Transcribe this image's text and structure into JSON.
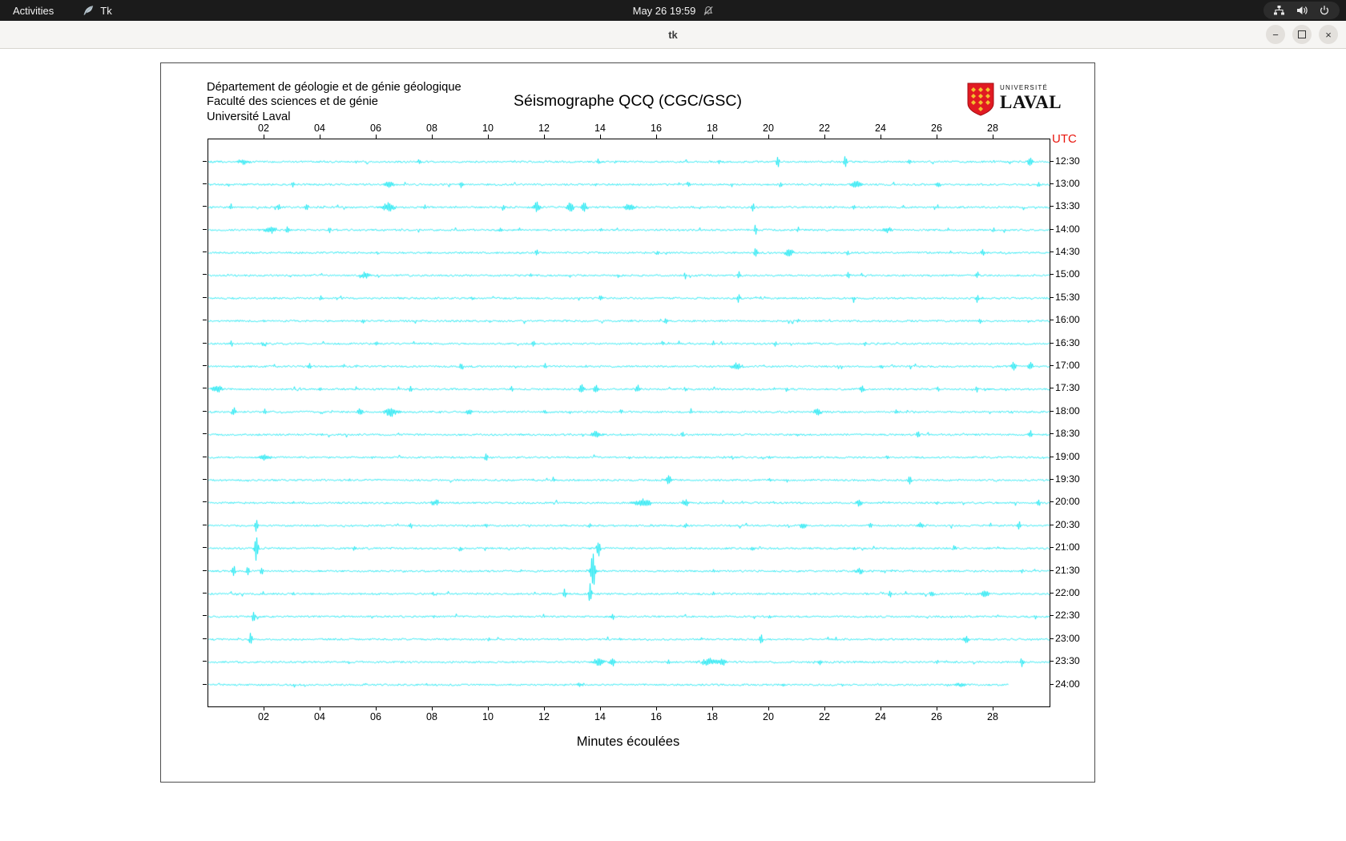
{
  "top_bar": {
    "activities_label": "Activities",
    "app_name": "Tk",
    "clock": "May 26 19:59"
  },
  "window": {
    "title": "tk",
    "minimize_glyph": "−",
    "close_glyph": "×"
  },
  "header": {
    "dept_lines": [
      "Département de géologie et de génie géologique",
      "Faculté des sciences et de génie",
      "Université Laval"
    ],
    "title": "Séismographe QCQ (CGC/GSC)",
    "logo": {
      "top": "UNIVERSITÉ",
      "bottom": "LAVAL"
    }
  },
  "colors": {
    "trace": "#00e4f0",
    "utc_label": "#e8150d",
    "topbar_bg": "#1b1b1b",
    "titlebar_bg": "#f6f5f3",
    "logo_red": "#e11a22",
    "logo_gold": "#f2c12e"
  },
  "chart_data": {
    "type": "line",
    "title": "Séismographe QCQ (CGC/GSC)",
    "xlabel": "Minutes écoulées",
    "right_axis_label": "UTC",
    "x_range": [
      0,
      30
    ],
    "x_ticks": [
      "02",
      "04",
      "06",
      "08",
      "10",
      "12",
      "14",
      "16",
      "18",
      "20",
      "22",
      "24",
      "26",
      "28"
    ],
    "trace_color": "#00e4f0",
    "noise_amp": 1.1,
    "rows": [
      {
        "utc": "12:30",
        "events": [
          [
            1.2,
            3,
            0.25
          ],
          [
            7.5,
            4,
            0.05
          ],
          [
            13.9,
            4,
            0.05
          ],
          [
            18.2,
            3,
            0.05
          ],
          [
            20.3,
            9,
            0.05
          ],
          [
            22.7,
            9,
            0.05
          ],
          [
            25.0,
            3,
            0.05
          ],
          [
            29.3,
            6,
            0.1
          ]
        ]
      },
      {
        "utc": "13:00",
        "events": [
          [
            3.0,
            3,
            0.05
          ],
          [
            6.4,
            4,
            0.18
          ],
          [
            9.0,
            4,
            0.05
          ],
          [
            13.8,
            3,
            0.05
          ],
          [
            17.1,
            4,
            0.05
          ],
          [
            20.4,
            3,
            0.05
          ],
          [
            23.1,
            5,
            0.18
          ],
          [
            26.0,
            3,
            0.1
          ],
          [
            29.6,
            5,
            0.05
          ]
        ]
      },
      {
        "utc": "13:30",
        "events": [
          [
            0.8,
            4,
            0.05
          ],
          [
            2.5,
            4,
            0.05
          ],
          [
            3.5,
            4,
            0.05
          ],
          [
            6.4,
            6,
            0.22
          ],
          [
            7.7,
            4,
            0.05
          ],
          [
            10.5,
            4,
            0.05
          ],
          [
            11.7,
            7,
            0.1
          ],
          [
            12.9,
            6,
            0.12
          ],
          [
            13.4,
            6,
            0.1
          ],
          [
            15.0,
            5,
            0.18
          ],
          [
            19.4,
            6,
            0.05
          ],
          [
            23.0,
            3,
            0.05
          ],
          [
            26.0,
            3,
            0.05
          ]
        ]
      },
      {
        "utc": "14:00",
        "events": [
          [
            2.2,
            4,
            0.22
          ],
          [
            2.8,
            5,
            0.05
          ],
          [
            4.3,
            5,
            0.05
          ],
          [
            10.4,
            3,
            0.05
          ],
          [
            14.0,
            3,
            0.05
          ],
          [
            19.5,
            8,
            0.05
          ],
          [
            21.0,
            4,
            0.05
          ],
          [
            24.2,
            4,
            0.15
          ],
          [
            28.0,
            3,
            0.05
          ]
        ]
      },
      {
        "utc": "14:30",
        "events": [
          [
            6.0,
            3,
            0.05
          ],
          [
            11.7,
            4,
            0.05
          ],
          [
            16.0,
            3,
            0.05
          ],
          [
            19.5,
            7,
            0.05
          ],
          [
            20.7,
            5,
            0.15
          ],
          [
            22.8,
            4,
            0.05
          ],
          [
            27.6,
            4,
            0.05
          ]
        ]
      },
      {
        "utc": "15:00",
        "events": [
          [
            5.6,
            4,
            0.18
          ],
          [
            11.5,
            3,
            0.05
          ],
          [
            14.6,
            3,
            0.05
          ],
          [
            17.0,
            4,
            0.05
          ],
          [
            18.9,
            5,
            0.05
          ],
          [
            22.8,
            5,
            0.05
          ],
          [
            27.4,
            4,
            0.05
          ]
        ]
      },
      {
        "utc": "15:30",
        "events": [
          [
            4.0,
            3,
            0.05
          ],
          [
            9.4,
            3,
            0.05
          ],
          [
            14.0,
            3,
            0.05
          ],
          [
            18.9,
            5,
            0.05
          ],
          [
            23.0,
            3,
            0.05
          ],
          [
            27.4,
            6,
            0.05
          ]
        ]
      },
      {
        "utc": "16:00",
        "events": [
          [
            2.0,
            2,
            0.05
          ],
          [
            5.5,
            3,
            0.05
          ],
          [
            10.0,
            2,
            0.05
          ],
          [
            16.3,
            4,
            0.05
          ],
          [
            21.0,
            2,
            0.05
          ],
          [
            27.5,
            4,
            0.05
          ]
        ]
      },
      {
        "utc": "16:30",
        "events": [
          [
            0.8,
            4,
            0.05
          ],
          [
            2.0,
            4,
            0.1
          ],
          [
            6.0,
            3,
            0.05
          ],
          [
            11.6,
            4,
            0.05
          ],
          [
            16.2,
            4,
            0.05
          ],
          [
            18.0,
            4,
            0.05
          ],
          [
            20.2,
            4,
            0.05
          ],
          [
            23.4,
            3,
            0.05
          ]
        ]
      },
      {
        "utc": "17:00",
        "events": [
          [
            3.6,
            5,
            0.05
          ],
          [
            9.0,
            5,
            0.05
          ],
          [
            12.0,
            3,
            0.05
          ],
          [
            18.8,
            4,
            0.18
          ],
          [
            24.0,
            3,
            0.05
          ],
          [
            28.7,
            6,
            0.08
          ],
          [
            29.3,
            6,
            0.08
          ]
        ]
      },
      {
        "utc": "17:30",
        "events": [
          [
            0.3,
            5,
            0.18
          ],
          [
            4.0,
            3,
            0.05
          ],
          [
            7.2,
            5,
            0.05
          ],
          [
            10.8,
            3,
            0.05
          ],
          [
            13.3,
            7,
            0.08
          ],
          [
            13.8,
            7,
            0.08
          ],
          [
            15.3,
            5,
            0.1
          ],
          [
            17.0,
            3,
            0.05
          ],
          [
            20.6,
            3,
            0.05
          ],
          [
            23.3,
            5,
            0.08
          ],
          [
            26.0,
            3,
            0.05
          ],
          [
            27.4,
            4,
            0.05
          ]
        ]
      },
      {
        "utc": "18:00",
        "events": [
          [
            0.9,
            5,
            0.08
          ],
          [
            2.0,
            3,
            0.05
          ],
          [
            5.4,
            4,
            0.1
          ],
          [
            6.5,
            6,
            0.22
          ],
          [
            9.3,
            4,
            0.14
          ],
          [
            12.0,
            3,
            0.05
          ],
          [
            14.7,
            4,
            0.05
          ],
          [
            17.2,
            4,
            0.05
          ],
          [
            21.7,
            4,
            0.14
          ],
          [
            24.5,
            3,
            0.05
          ]
        ]
      },
      {
        "utc": "18:30",
        "events": [
          [
            4.0,
            2,
            0.05
          ],
          [
            9.0,
            2,
            0.05
          ],
          [
            13.8,
            4,
            0.18
          ],
          [
            16.9,
            4,
            0.05
          ],
          [
            21.0,
            2,
            0.05
          ],
          [
            25.3,
            4,
            0.05
          ],
          [
            29.3,
            6,
            0.06
          ]
        ]
      },
      {
        "utc": "19:00",
        "events": [
          [
            2.0,
            4,
            0.18
          ],
          [
            9.9,
            5,
            0.05
          ],
          [
            15.0,
            2,
            0.05
          ],
          [
            20.0,
            2,
            0.05
          ],
          [
            24.2,
            3,
            0.05
          ]
        ]
      },
      {
        "utc": "19:30",
        "events": [
          [
            5.0,
            2,
            0.05
          ],
          [
            12.3,
            4,
            0.05
          ],
          [
            16.4,
            7,
            0.08
          ],
          [
            20.0,
            2,
            0.05
          ],
          [
            25.0,
            7,
            0.05
          ]
        ]
      },
      {
        "utc": "20:00",
        "events": [
          [
            3.0,
            2,
            0.05
          ],
          [
            8.1,
            4,
            0.14
          ],
          [
            15.5,
            5,
            0.28
          ],
          [
            17.0,
            4,
            0.14
          ],
          [
            23.2,
            4,
            0.1
          ],
          [
            26.0,
            2,
            0.05
          ],
          [
            29.6,
            5,
            0.05
          ]
        ]
      },
      {
        "utc": "20:30",
        "events": [
          [
            1.7,
            8,
            0.05
          ],
          [
            7.2,
            4,
            0.05
          ],
          [
            9.9,
            4,
            0.05
          ],
          [
            13.6,
            4,
            0.05
          ],
          [
            17.0,
            3,
            0.05
          ],
          [
            21.2,
            4,
            0.1
          ],
          [
            23.6,
            4,
            0.05
          ],
          [
            25.4,
            4,
            0.12
          ],
          [
            28.9,
            7,
            0.05
          ]
        ]
      },
      {
        "utc": "21:00",
        "events": [
          [
            1.7,
            16,
            0.07
          ],
          [
            5.2,
            4,
            0.05
          ],
          [
            9.0,
            3,
            0.05
          ],
          [
            13.9,
            12,
            0.06
          ],
          [
            19.4,
            4,
            0.05
          ],
          [
            23.0,
            2,
            0.05
          ],
          [
            26.6,
            4,
            0.05
          ]
        ]
      },
      {
        "utc": "21:30",
        "events": [
          [
            0.9,
            7,
            0.05
          ],
          [
            1.4,
            7,
            0.05
          ],
          [
            1.9,
            5,
            0.05
          ],
          [
            7.0,
            2,
            0.05
          ],
          [
            13.7,
            26,
            0.07
          ],
          [
            18.0,
            2,
            0.05
          ],
          [
            23.2,
            4,
            0.12
          ],
          [
            29.0,
            3,
            0.05
          ]
        ]
      },
      {
        "utc": "22:00",
        "events": [
          [
            3.0,
            2,
            0.05
          ],
          [
            8.0,
            2,
            0.05
          ],
          [
            12.7,
            6,
            0.05
          ],
          [
            13.6,
            13,
            0.05
          ],
          [
            18.0,
            2,
            0.05
          ],
          [
            24.3,
            4,
            0.05
          ],
          [
            25.8,
            4,
            0.08
          ],
          [
            27.7,
            5,
            0.12
          ]
        ]
      },
      {
        "utc": "22:30",
        "events": [
          [
            1.6,
            8,
            0.05
          ],
          [
            8.0,
            2,
            0.05
          ],
          [
            14.4,
            4,
            0.05
          ],
          [
            20.0,
            2,
            0.05
          ],
          [
            26.5,
            2,
            0.05
          ]
        ]
      },
      {
        "utc": "23:00",
        "events": [
          [
            1.5,
            9,
            0.05
          ],
          [
            10.0,
            2,
            0.05
          ],
          [
            19.7,
            7,
            0.05
          ],
          [
            24.0,
            2,
            0.05
          ],
          [
            27.0,
            4,
            0.14
          ]
        ]
      },
      {
        "utc": "23:30",
        "events": [
          [
            5.0,
            2,
            0.05
          ],
          [
            13.9,
            5,
            0.18
          ],
          [
            14.4,
            5,
            0.1
          ],
          [
            16.4,
            4,
            0.05
          ],
          [
            17.8,
            5,
            0.26
          ],
          [
            18.3,
            5,
            0.18
          ],
          [
            21.8,
            4,
            0.05
          ],
          [
            26.0,
            2,
            0.05
          ],
          [
            29.0,
            7,
            0.05
          ]
        ]
      },
      {
        "utc": "24:00",
        "end": 28.5,
        "events": [
          [
            7.8,
            2,
            0.05
          ],
          [
            13.2,
            3,
            0.1
          ],
          [
            20.5,
            2,
            0.05
          ],
          [
            26.8,
            3,
            0.18
          ]
        ]
      }
    ]
  }
}
